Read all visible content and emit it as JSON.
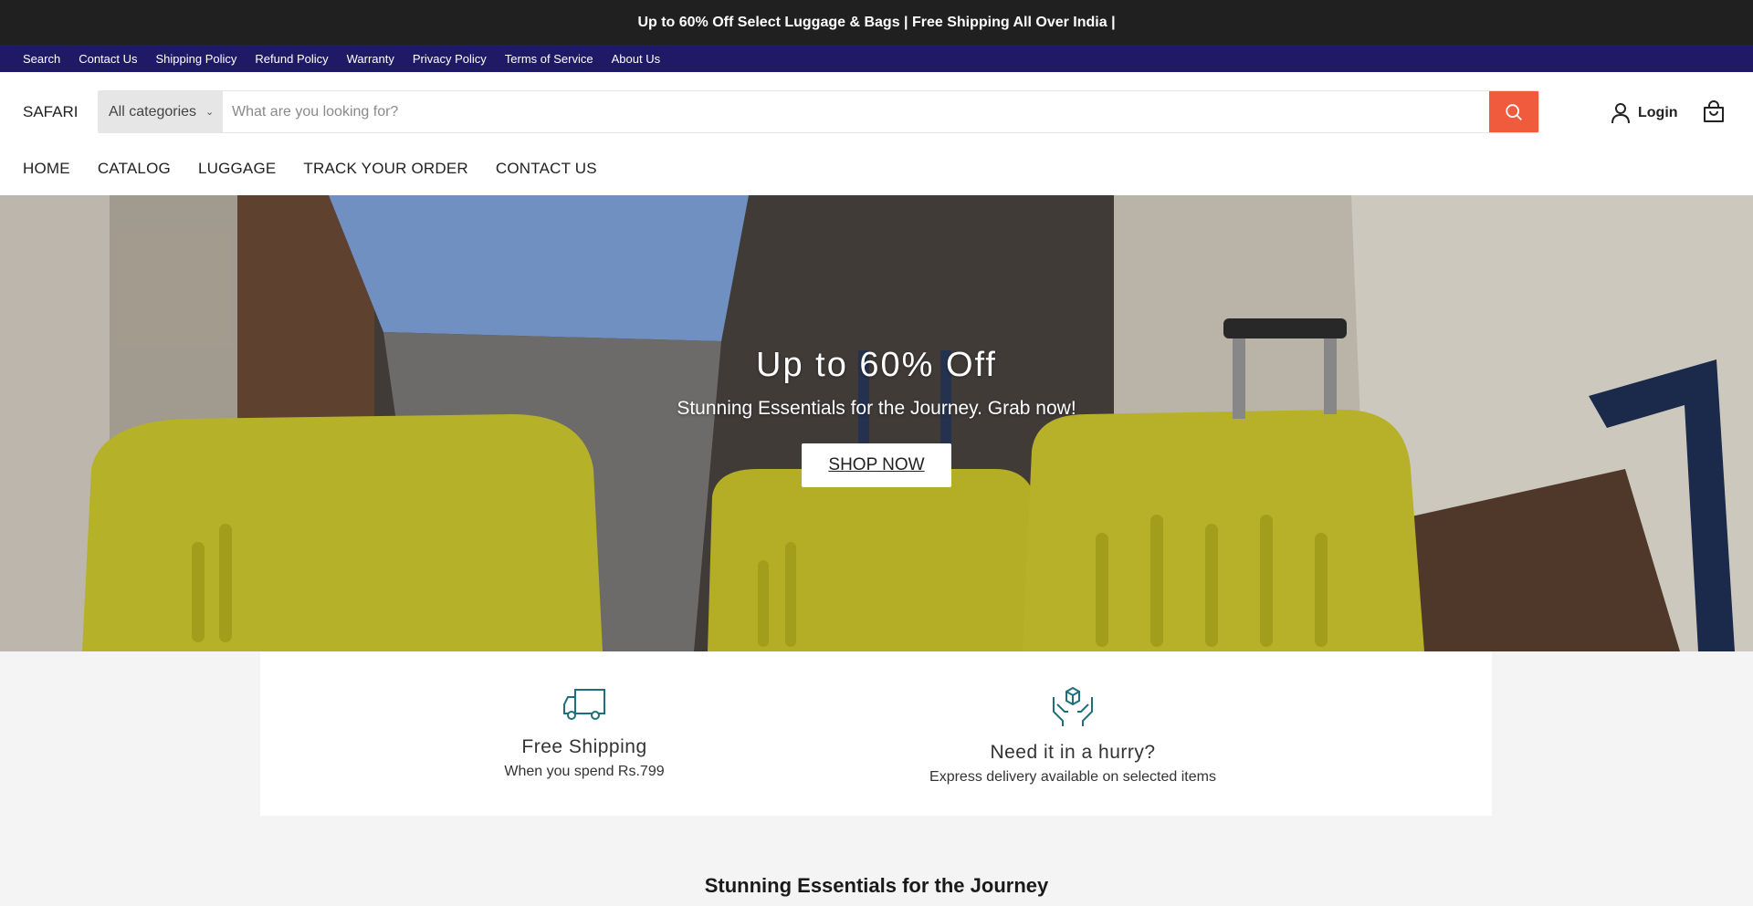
{
  "announcement": "Up to 60% Off Select Luggage & Bags | Free Shipping All Over India |",
  "utility_links": [
    "Search",
    "Contact Us",
    "Shipping Policy",
    "Refund Policy",
    "Warranty",
    "Privacy Policy",
    "Terms of Service",
    "About Us"
  ],
  "header": {
    "brand": "SAFARI",
    "category_select": "All categories",
    "search_placeholder": "What are you looking for?",
    "login_label": "Login"
  },
  "main_nav": [
    "HOME",
    "CATALOG",
    "LUGGAGE",
    "TRACK YOUR ORDER",
    "CONTACT US"
  ],
  "hero": {
    "title": "Up to 60% Off",
    "subtitle": "Stunning Essentials for the Journey. Grab now!",
    "button": "SHOP NOW"
  },
  "features": [
    {
      "icon": "truck-icon",
      "title": "Free Shipping",
      "subtitle": "When you spend Rs.799"
    },
    {
      "icon": "hands-box-icon",
      "title": "Need it in a hurry?",
      "subtitle": "Express delivery available on selected items"
    }
  ],
  "section_title": "Stunning Essentials for the Journey",
  "colors": {
    "announcement_bg": "#202020",
    "utility_bg": "#1f1a66",
    "search_button": "#f05a3d",
    "feature_icon": "#1f6f7a"
  }
}
